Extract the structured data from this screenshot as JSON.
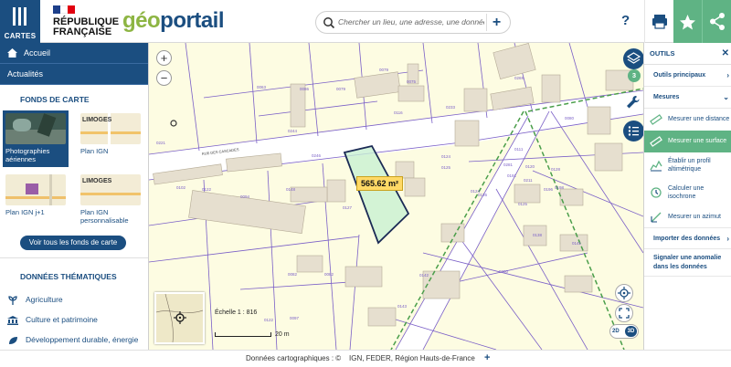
{
  "header": {
    "menu_label": "CARTES",
    "republique_line1": "RÉPUBLIQUE",
    "republique_line2": "FRANÇAISE",
    "logo_geo": "géo",
    "logo_portail": "portail",
    "search_placeholder": "Chercher un lieu, une adresse, une donnée,",
    "help_label": "?",
    "colors": {
      "brand": "#1b4e80",
      "accent": "#5fb384",
      "logo_green": "#8db543"
    }
  },
  "sidebar": {
    "nav": [
      {
        "label": "Accueil",
        "icon": "home-icon"
      },
      {
        "label": "Actualités"
      }
    ],
    "basemaps_title": "FONDS DE CARTE",
    "basemaps": [
      {
        "label": "Photographies aériennes",
        "selected": true
      },
      {
        "label": "Plan IGN",
        "thumb_text": "LIMOGES"
      },
      {
        "label": "Plan IGN j+1"
      },
      {
        "label": "Plan IGN personnalisable",
        "thumb_text": "LIMOGES"
      }
    ],
    "see_all_label": "Voir tous les fonds de carte",
    "thematic_title": "DONNÉES THÉMATIQUES",
    "thematic": [
      {
        "label": "Agriculture",
        "icon": "sprout-icon"
      },
      {
        "label": "Culture et patrimoine",
        "icon": "museum-icon"
      },
      {
        "label": "Développement durable, énergie",
        "icon": "leaf-icon"
      }
    ]
  },
  "map": {
    "zoom_in": "+",
    "zoom_out": "−",
    "measured_area": "565.62 m²",
    "street_label": "RUE DES CASCADES",
    "scale_label": "Échelle 1 : 816",
    "scale_distance": "20 m",
    "layers_count": "3",
    "mode_2d": "2D",
    "mode_3d": "3D",
    "parcel_numbers": [
      "0063",
      "0079",
      "0086",
      "0079",
      "0075",
      "0116",
      "0244",
      "0221",
      "0233",
      "0269",
      "0080",
      "0124",
      "0111",
      "0124",
      "0129",
      "0246",
      "0094",
      "0102",
      "0148",
      "0122",
      "0127",
      "0126",
      "0125",
      "0211",
      "0281",
      "0191",
      "0125",
      "0141",
      "0120",
      "0128",
      "0198",
      "0138",
      "0196",
      "0097",
      "0082",
      "0082",
      "0122",
      "0143",
      "0142",
      "0200"
    ]
  },
  "tools": {
    "title": "OUTILS",
    "groups": [
      {
        "label": "Outils principaux"
      },
      {
        "label": "Mesures"
      }
    ],
    "items": [
      {
        "label": "Mesurer une distance",
        "active": false
      },
      {
        "label": "Mesurer une surface",
        "active": true
      },
      {
        "label": "Établir un profil altimétrique",
        "active": false
      },
      {
        "label": "Calculer une isochrone",
        "active": false
      },
      {
        "label": "Mesurer un azimut",
        "active": false
      }
    ],
    "import_label": "Importer des données",
    "report_label": "Signaler une anomalie dans les données"
  },
  "footer": {
    "credits": "Données cartographiques : ©",
    "sources": "IGN,  FEDER,  Région Hauts-de-France",
    "plus": "+"
  }
}
